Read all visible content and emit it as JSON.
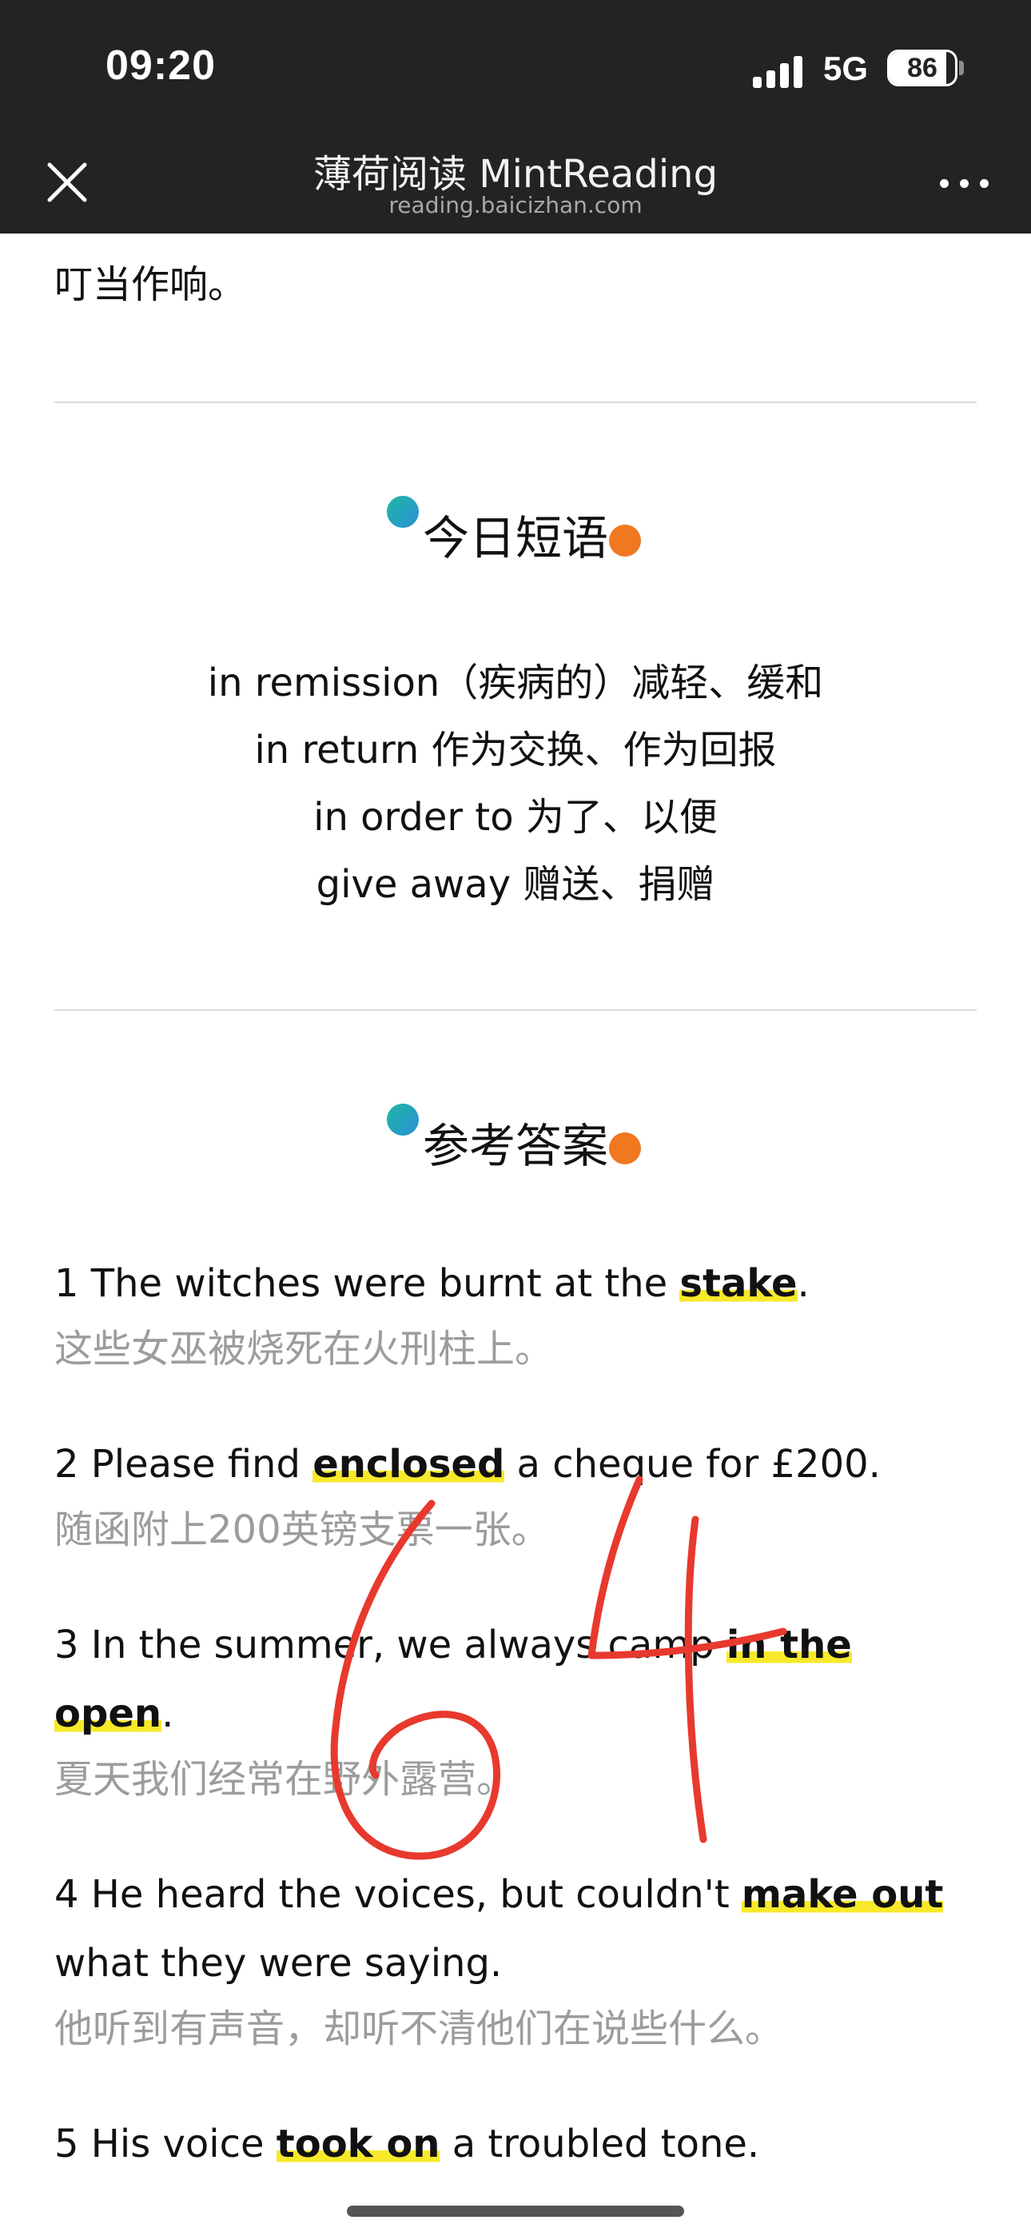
{
  "status_bar": {
    "time": "09:20",
    "network": "5G",
    "battery": "86",
    "battery_level_percent": 86
  },
  "nav": {
    "title": "薄荷阅读 MintReading",
    "subtitle": "reading.baicizhan.com",
    "close_icon": "close-icon",
    "more_icon": "more-icon"
  },
  "article_tail": "叮当作响。",
  "phrases_section": {
    "title": "今日短语",
    "items": [
      "in remission（疾病的）减轻、缓和",
      "in return 作为交换、作为回报",
      "in order to 为了、以便",
      "give away 赠送、捐赠"
    ]
  },
  "answers_section": {
    "title": "参考答案",
    "items": [
      {
        "pre": "1 The witches were burnt at the ",
        "key": "stake",
        "post": ".",
        "cn": "这些女巫被烧死在火刑柱上。"
      },
      {
        "pre": "2 Please find ",
        "key": "enclosed",
        "post": " a cheque for £200.",
        "cn": "随函附上200英镑支票一张。"
      },
      {
        "pre": "3 In the summer, we always camp ",
        "key": "in the open",
        "post": ".",
        "cn": "夏天我们经常在野外露营。"
      },
      {
        "pre": "4 He heard the voices, but couldn't ",
        "key": "make out",
        "post": " what they were saying.",
        "cn": "他听到有声音，却听不清他们在说些什么。"
      },
      {
        "pre": "5 His voice ",
        "key": "took on",
        "post": " a troubled tone.",
        "cn": ""
      }
    ]
  },
  "handwritten_annotation": "64",
  "colors": {
    "topbar": "#232323",
    "highlight": "#f7e92a",
    "dot_teal": "#1fb8a4",
    "dot_orange": "#f07820",
    "ink": "#e8392e"
  }
}
